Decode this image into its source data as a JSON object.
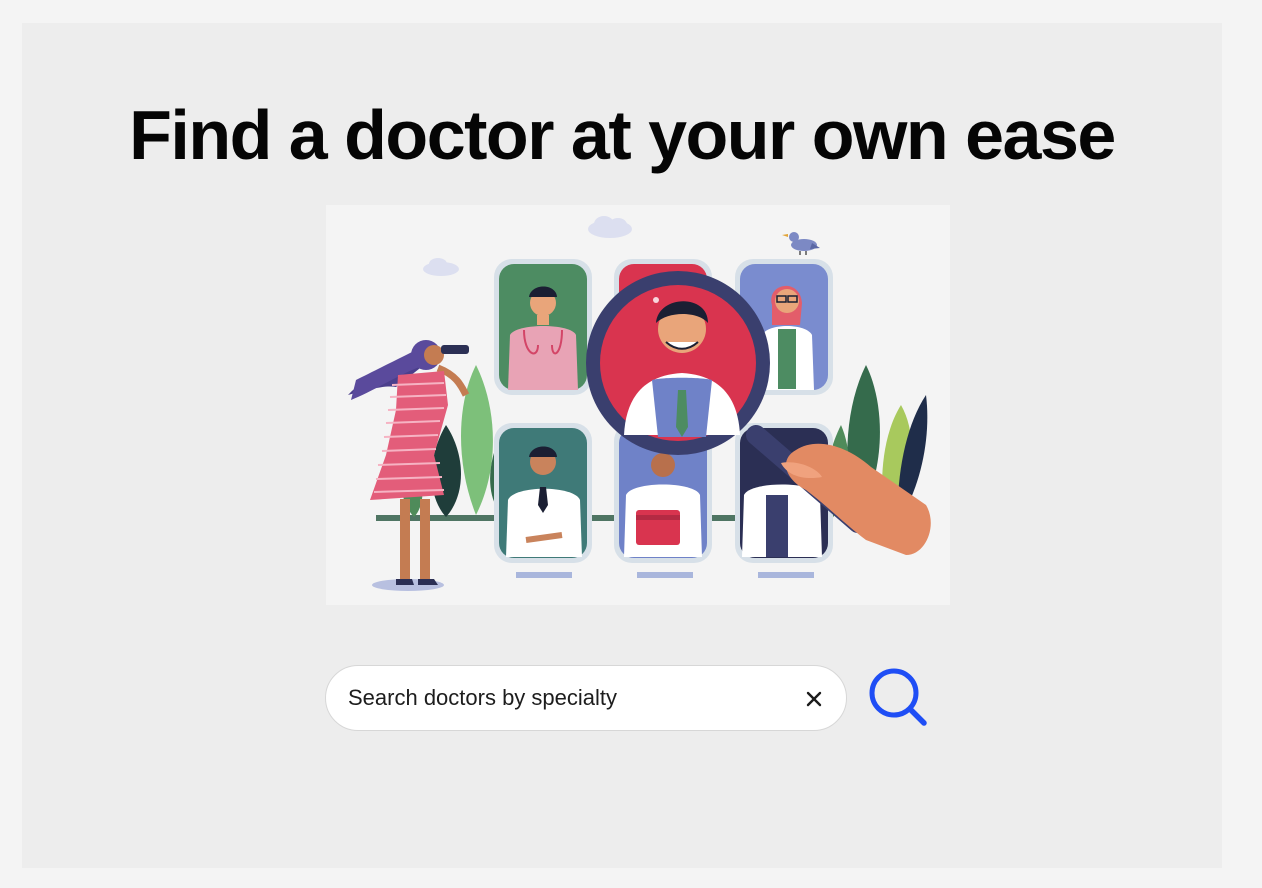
{
  "header": {
    "title": "Find a doctor at your own ease"
  },
  "hero": {
    "illustration": "doctor-search-illustration"
  },
  "search": {
    "placeholder": "Search doctors by specialty",
    "value": "",
    "clear_icon": "close-icon",
    "submit_icon": "search-icon"
  },
  "colors": {
    "page_background": "#f4f4f4",
    "panel_background": "#ededed",
    "title_text": "#050505",
    "accent": "#1f4ef5",
    "input_background": "#ffffff",
    "input_border": "#d7d7d7"
  }
}
